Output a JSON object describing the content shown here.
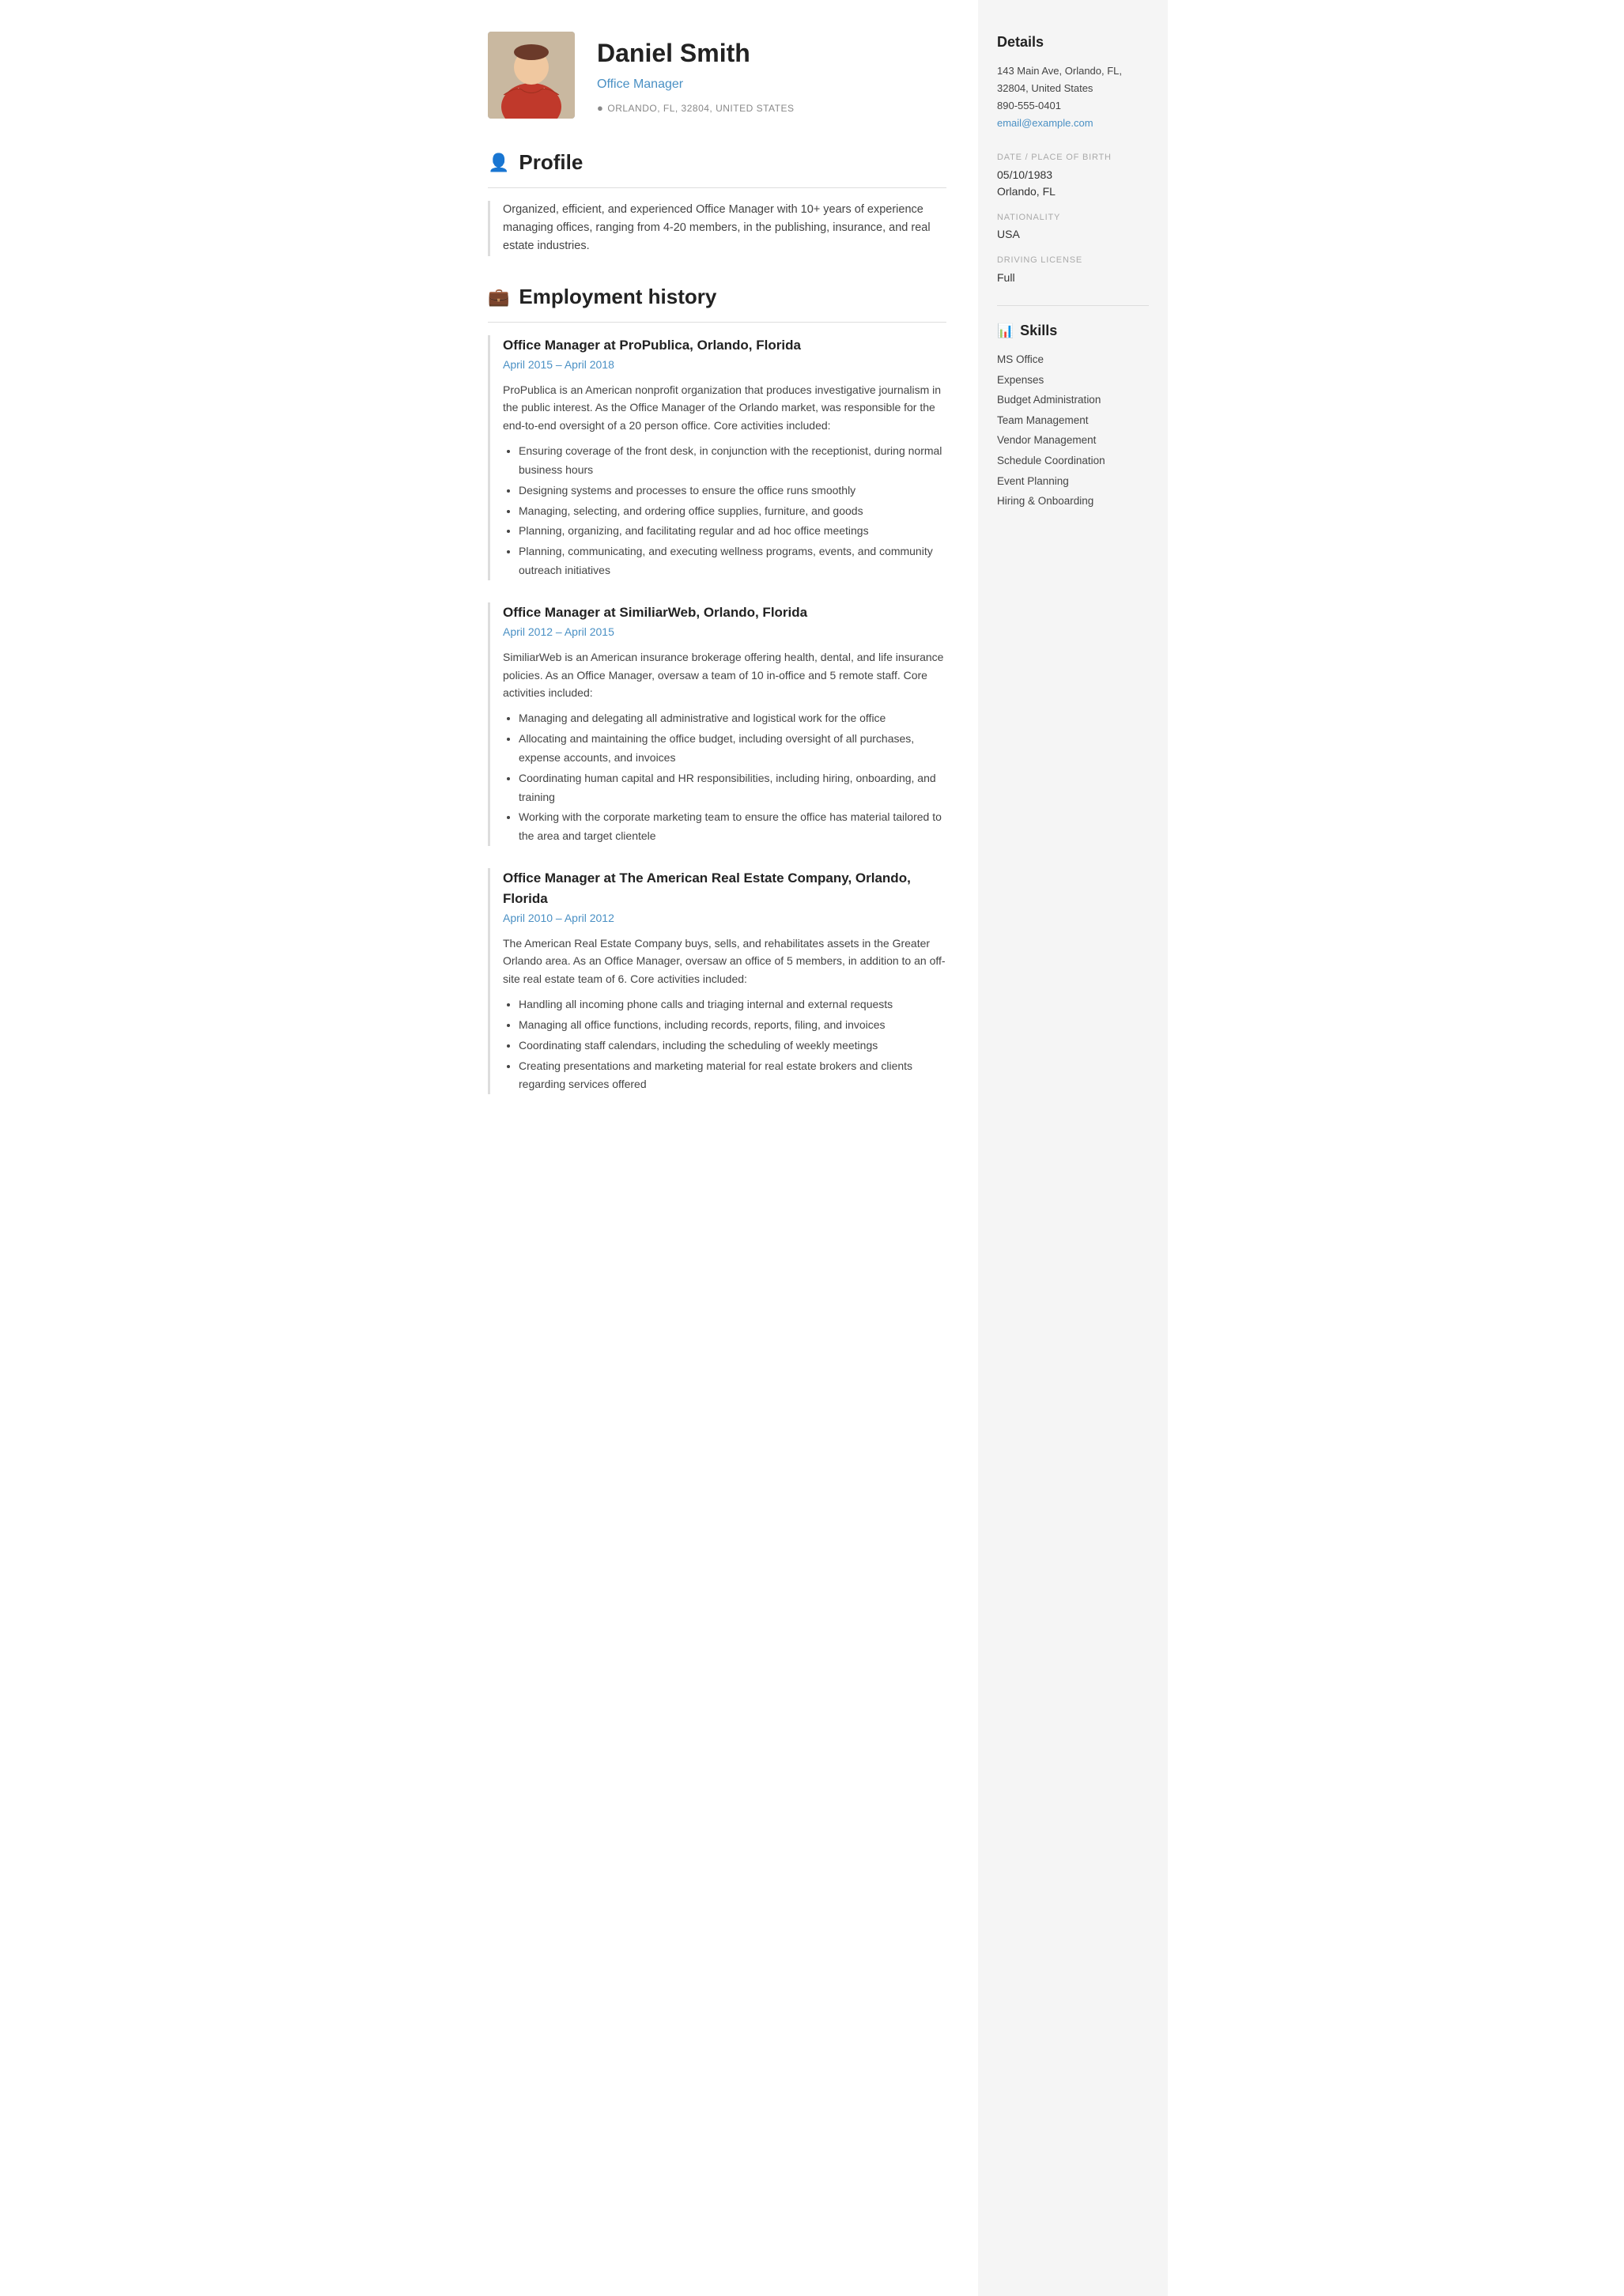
{
  "header": {
    "name": "Daniel Smith",
    "job_title": "Office Manager",
    "location": "ORLANDO, FL, 32804, UNITED STATES"
  },
  "sections": {
    "profile": {
      "title": "Profile",
      "text": "Organized, efficient, and experienced Office Manager with 10+ years of experience managing offices, ranging from 4-20 members, in the publishing, insurance, and real estate industries."
    },
    "employment": {
      "title": "Employment history",
      "jobs": [
        {
          "title": "Office Manager at ProPublica, Orlando, Florida",
          "dates": "April 2015  –  April 2018",
          "description": "ProPublica is an American nonprofit organization that produces investigative journalism in the public interest. As the Office Manager of the Orlando market, was responsible for the end-to-end oversight of a 20 person office. Core activities included:",
          "bullets": [
            "Ensuring coverage of the front desk, in conjunction with the receptionist, during normal business hours",
            "Designing systems and processes to ensure the office runs smoothly",
            "Managing, selecting, and ordering office supplies, furniture, and goods",
            "Planning, organizing, and facilitating regular and ad hoc office meetings",
            "Planning, communicating, and executing wellness programs, events, and community outreach initiatives"
          ]
        },
        {
          "title": "Office Manager at SimiliarWeb, Orlando, Florida",
          "dates": "April 2012  –  April 2015",
          "description": "SimiliarWeb is an American insurance brokerage offering health, dental, and life insurance policies. As an Office Manager, oversaw a team of 10 in-office and 5 remote staff. Core activities included:",
          "bullets": [
            "Managing and delegating all administrative and logistical work for the office",
            "Allocating and maintaining the office budget, including oversight of all purchases, expense accounts, and invoices",
            "Coordinating human capital and HR responsibilities, including hiring, onboarding, and training",
            "Working with the corporate marketing team to ensure the office has material tailored to the area and target clientele"
          ]
        },
        {
          "title": "Office Manager at The American Real Estate Company, Orlando, Florida",
          "dates": "April 2010  –  April 2012",
          "description": "The American Real Estate Company buys, sells, and rehabilitates assets in the Greater Orlando area. As an Office Manager, oversaw an office of 5 members, in addition to an off-site real estate team of 6. Core activities included:",
          "bullets": [
            "Handling all incoming phone calls and triaging internal and external requests",
            "Managing all office functions, including records, reports, filing, and invoices",
            "Coordinating staff calendars, including the scheduling of weekly meetings",
            "Creating presentations and marketing material for real estate brokers and clients regarding services offered"
          ]
        }
      ]
    }
  },
  "sidebar": {
    "details_title": "Details",
    "address": "143 Main Ave, Orlando, FL, 32804, United States",
    "phone": "890-555-0401",
    "email": "email@example.com",
    "dob_label": "DATE / PLACE OF BIRTH",
    "dob": "05/10/1983",
    "dob_place": "Orlando, FL",
    "nationality_label": "NATIONALITY",
    "nationality": "USA",
    "driving_label": "DRIVING LICENSE",
    "driving": "Full",
    "skills_title": "Skills",
    "skills": [
      "MS Office",
      "Expenses",
      "Budget Administration",
      "Team Management",
      "Vendor Management",
      "Schedule Coordination",
      "Event Planning",
      "Hiring & Onboarding"
    ]
  }
}
